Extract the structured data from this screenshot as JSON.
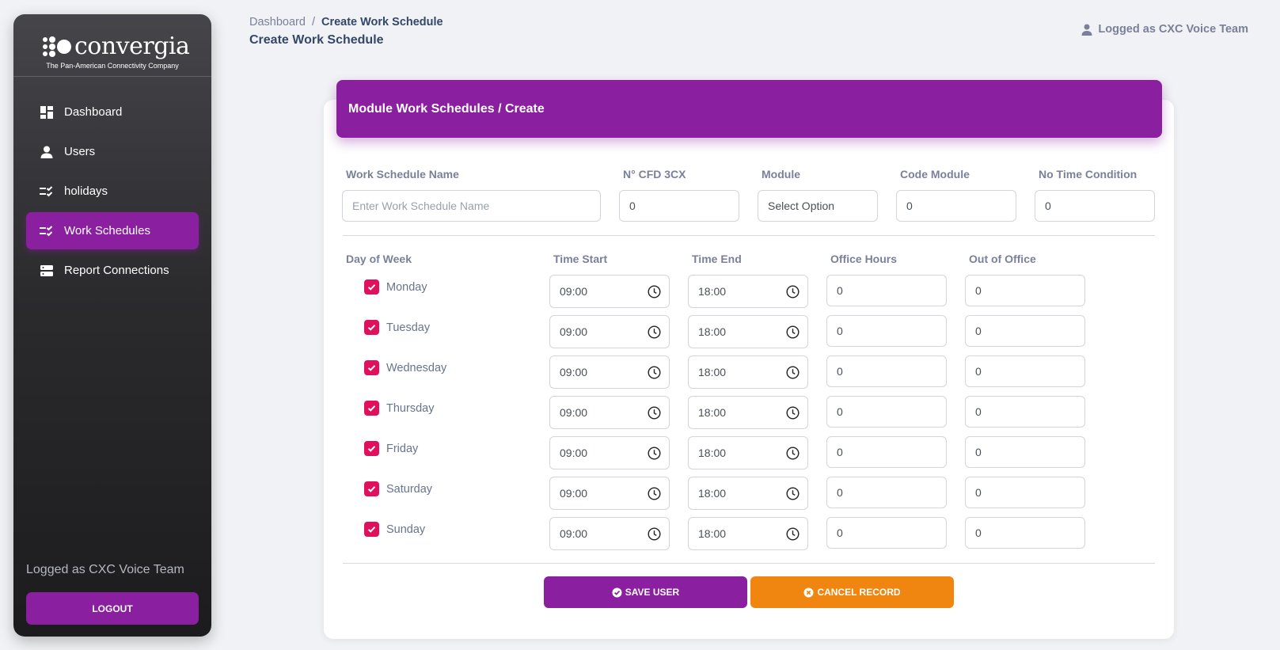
{
  "sidebar": {
    "logo_word": "convergia",
    "logo_tagline": "The Pan-American Connectivity Company",
    "items": [
      {
        "label": "Dashboard",
        "icon": "dashboard-icon",
        "active": false
      },
      {
        "label": "Users",
        "icon": "user-icon",
        "active": false
      },
      {
        "label": "holidays",
        "icon": "checklist-icon",
        "active": false
      },
      {
        "label": "Work Schedules",
        "icon": "checklist-icon",
        "active": true
      },
      {
        "label": "Report Connections",
        "icon": "server-icon",
        "active": false
      }
    ],
    "logged_text": "Logged as CXC Voice Team",
    "logout_label": "LOGOUT"
  },
  "header": {
    "breadcrumb_root": "Dashboard",
    "breadcrumb_sep": "/",
    "breadcrumb_current": "Create Work Schedule",
    "page_title": "Create Work Schedule",
    "user_text": "Logged as CXC Voice Team"
  },
  "card": {
    "title": "Module Work Schedules / Create"
  },
  "form": {
    "labels": {
      "name": "Work Schedule Name",
      "cfd": "N° CFD 3CX",
      "module": "Module",
      "code_module": "Code Module",
      "no_time": "No Time Condition"
    },
    "name_placeholder": "Enter Work Schedule Name",
    "cfd_value": "0",
    "module_value": "Select Option",
    "code_module_value": "0",
    "no_time_value": "0"
  },
  "schedule": {
    "headers": {
      "day": "Day of Week",
      "start": "Time Start",
      "end": "Time End",
      "office": "Office Hours",
      "out": "Out of Office"
    },
    "rows": [
      {
        "day": "Monday",
        "checked": true,
        "start": "09:00",
        "end": "18:00",
        "office": "0",
        "out": "0"
      },
      {
        "day": "Tuesday",
        "checked": true,
        "start": "09:00",
        "end": "18:00",
        "office": "0",
        "out": "0"
      },
      {
        "day": "Wednesday",
        "checked": true,
        "start": "09:00",
        "end": "18:00",
        "office": "0",
        "out": "0"
      },
      {
        "day": "Thursday",
        "checked": true,
        "start": "09:00",
        "end": "18:00",
        "office": "0",
        "out": "0"
      },
      {
        "day": "Friday",
        "checked": true,
        "start": "09:00",
        "end": "18:00",
        "office": "0",
        "out": "0"
      },
      {
        "day": "Saturday",
        "checked": true,
        "start": "09:00",
        "end": "18:00",
        "office": "0",
        "out": "0"
      },
      {
        "day": "Sunday",
        "checked": true,
        "start": "09:00",
        "end": "18:00",
        "office": "0",
        "out": "0"
      }
    ]
  },
  "actions": {
    "save_label": "SAVE USER",
    "cancel_label": "CANCEL RECORD"
  },
  "colors": {
    "primary": "#8a1f9f",
    "accent_orange": "#f0860f",
    "checkbox": "#e0105f"
  }
}
